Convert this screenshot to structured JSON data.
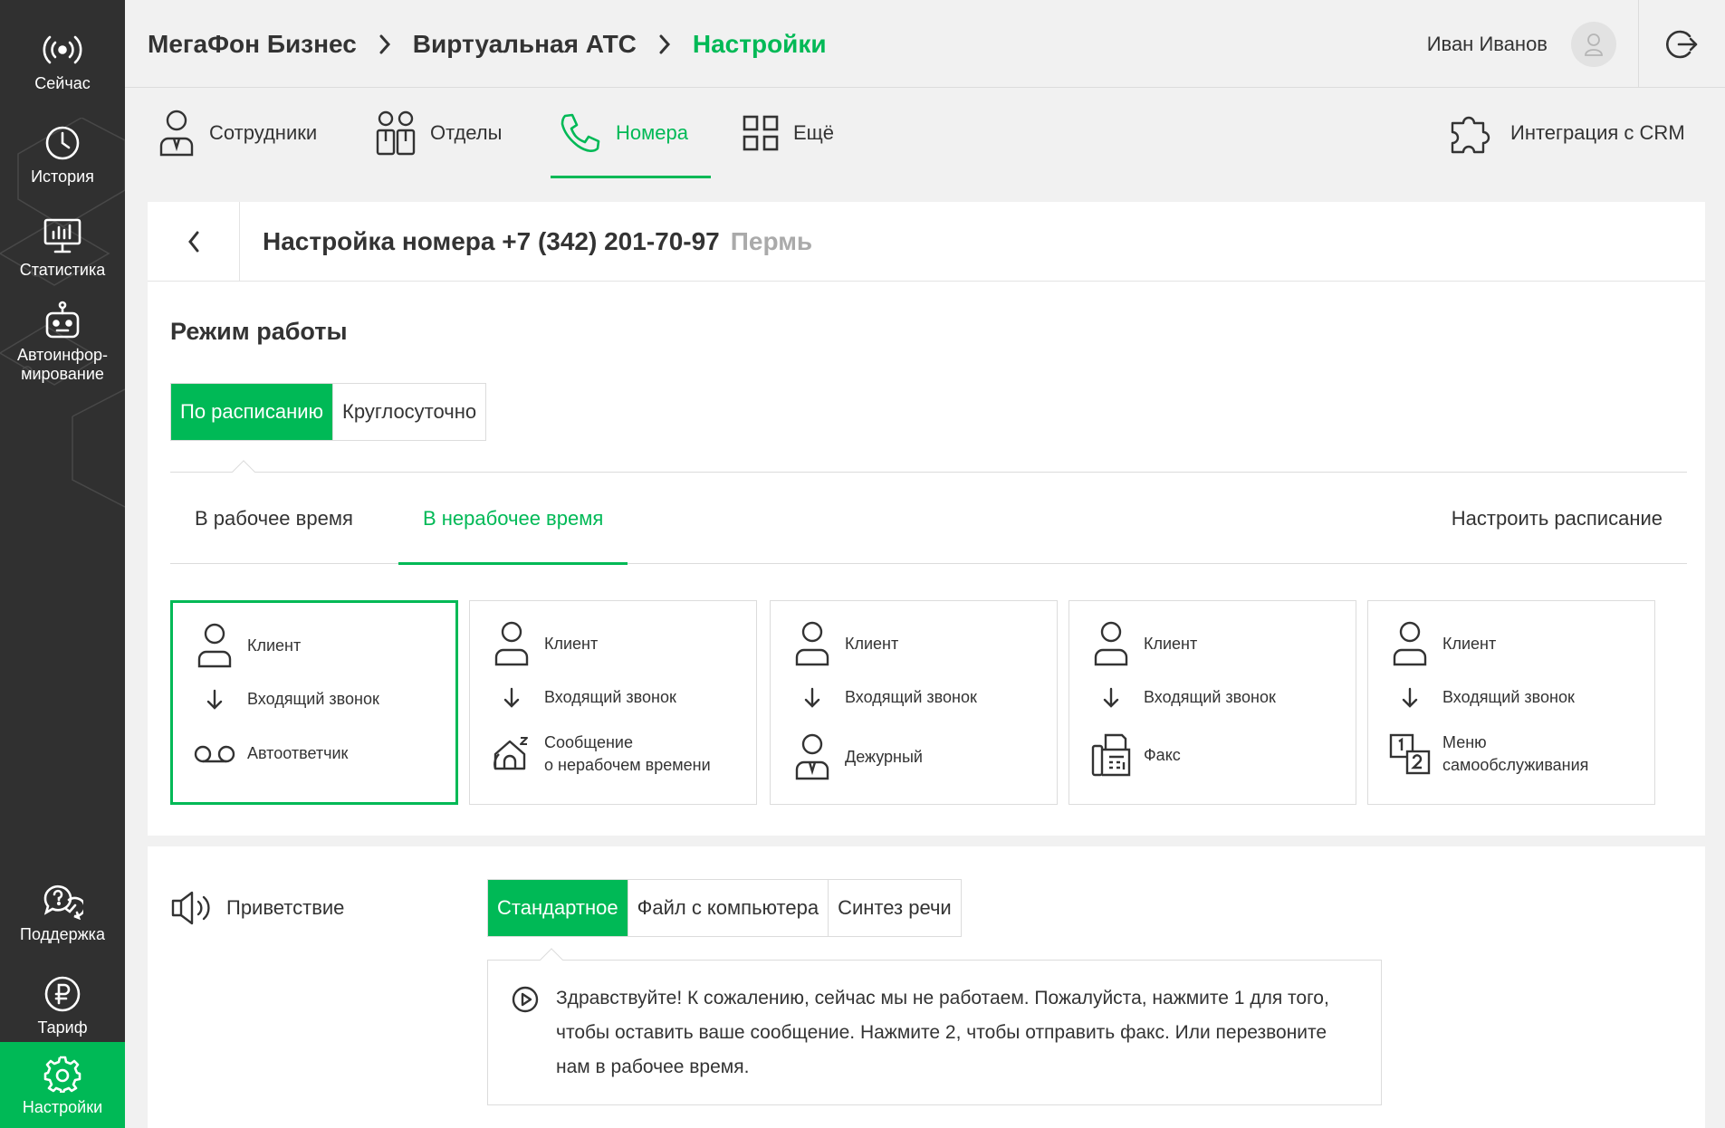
{
  "sidebar": {
    "items": [
      {
        "label": "Сейчас",
        "icon": "broadcast-icon"
      },
      {
        "label": "История",
        "icon": "clock-icon"
      },
      {
        "label": "Статистика",
        "icon": "chart-monitor-icon"
      },
      {
        "label": "Автоинфор-\nмирование",
        "icon": "robot-icon"
      },
      {
        "label": "Поддержка",
        "icon": "support-chat-icon"
      },
      {
        "label": "Тариф",
        "icon": "ruble-icon"
      },
      {
        "label": "Настройки",
        "icon": "gear-icon"
      }
    ]
  },
  "breadcrumbs": [
    "МегаФон Бизнес",
    "Виртуальная АТС",
    "Настройки"
  ],
  "user": {
    "name": "Иван Иванов"
  },
  "tabs": [
    {
      "label": "Сотрудники",
      "icon": "employee-icon"
    },
    {
      "label": "Отделы",
      "icon": "departments-icon"
    },
    {
      "label": "Номера",
      "icon": "phone-icon"
    },
    {
      "label": "Ещё",
      "icon": "grid-icon"
    },
    {
      "label": "Интеграция с CRM",
      "icon": "puzzle-icon"
    }
  ],
  "number_settings": {
    "title": "Настройка номера +7 (342) 201-70-97",
    "city": "Пермь"
  },
  "mode": {
    "title": "Режим работы",
    "options": [
      "По расписанию",
      "Круглосуточно"
    ],
    "selected": "По расписанию"
  },
  "time_tabs": {
    "work": "В рабочее время",
    "nonwork": "В нерабочее время",
    "schedule": "Настроить расписание"
  },
  "scenarios": [
    {
      "client": "Клиент",
      "call": "Входящий звонок",
      "action": "Автоответчик",
      "icon": "voicemail-icon"
    },
    {
      "client": "Клиент",
      "call": "Входящий звонок",
      "action": "Сообщение\nо нерабочем времени",
      "icon": "sleep-house-icon"
    },
    {
      "client": "Клиент",
      "call": "Входящий звонок",
      "action": "Дежурный",
      "icon": "duty-person-icon"
    },
    {
      "client": "Клиент",
      "call": "Входящий звонок",
      "action": "Факс",
      "icon": "fax-icon"
    },
    {
      "client": "Клиент",
      "call": "Входящий звонок",
      "action": "Меню\nсамообслуживания",
      "icon": "ivr-menu-icon"
    }
  ],
  "greeting": {
    "label": "Приветствие",
    "options": [
      "Стандартное",
      "Файл с компьютера",
      "Синтез речи"
    ],
    "selected": "Стандартное",
    "text": "Здравствуйте! К сожалению, сейчас мы не работаем. Пожалуйста, нажмите 1 для того, чтобы оставить ваше сообщение. Нажмите 2, чтобы отправить факс. Или перезвоните нам в рабочее время."
  },
  "colors": {
    "accent": "#00b956",
    "sidebar": "#303030",
    "background": "#f1f1f1"
  }
}
